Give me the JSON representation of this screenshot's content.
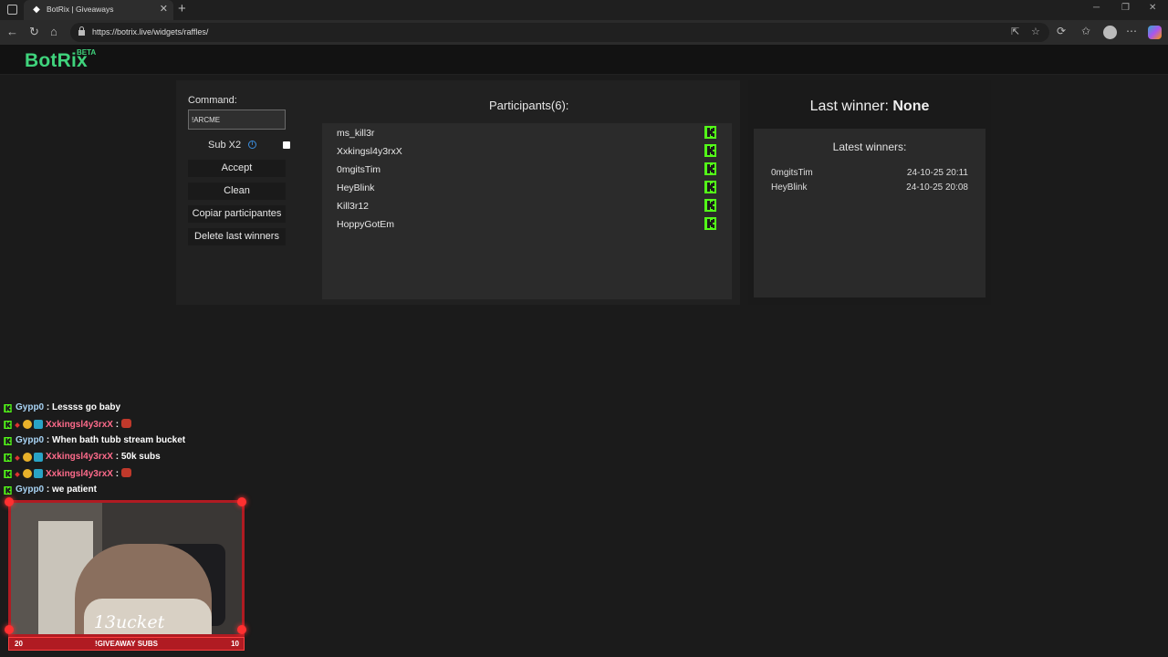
{
  "browser": {
    "tab_title": "BotRix | Giveaways",
    "url": "https://botrix.live/widgets/raffles/"
  },
  "brand": {
    "logo": "BotRix",
    "badge": "BETA",
    "color": "#3fd37c"
  },
  "controls": {
    "command_label": "Command:",
    "command_value": "!ARCME",
    "sub_label": "Sub X2",
    "sub_checked": false,
    "buttons": [
      "Accept",
      "Clean",
      "Copiar participantes",
      "Delete last winners"
    ]
  },
  "participants": {
    "title": "Participants(6):",
    "items": [
      "ms_kill3r",
      "Xxkingsl4y3rxX",
      "0mgitsTim",
      "HeyBlink",
      "Kill3r12",
      "HoppyGotEm"
    ],
    "platform_icon": "kick-icon",
    "accent": "#53fc18"
  },
  "winners": {
    "last_label": "Last winner:",
    "last_value": "None",
    "latest_title": "Latest winners:",
    "items": [
      {
        "name": "0mgitsTim",
        "date": "24-10-25 20:11"
      },
      {
        "name": "HeyBlink",
        "date": "24-10-25 20:08"
      }
    ]
  },
  "chat": [
    {
      "user": "Gypp0",
      "color": "#a9d4f5",
      "badges": false,
      "message": ": Lessss go baby",
      "emote": false
    },
    {
      "user": "Xxkingsl4y3rxX",
      "color": "#ff6b8b",
      "badges": true,
      "message": ":",
      "emote": true
    },
    {
      "user": "Gypp0",
      "color": "#a9d4f5",
      "badges": false,
      "message": ": When bath tubb stream bucket",
      "emote": false
    },
    {
      "user": "Xxkingsl4y3rxX",
      "color": "#ff6b8b",
      "badges": true,
      "message": ": 50k subs",
      "emote": false
    },
    {
      "user": "Xxkingsl4y3rxX",
      "color": "#ff6b8b",
      "badges": true,
      "message": ":",
      "emote": true
    },
    {
      "user": "Gypp0",
      "color": "#a9d4f5",
      "badges": false,
      "message": ": we patient",
      "emote": false
    }
  ],
  "stream": {
    "name": "13ucket",
    "bar_left": "20",
    "bar_center": "!GIVEAWAY SUBS",
    "bar_right": "10"
  }
}
